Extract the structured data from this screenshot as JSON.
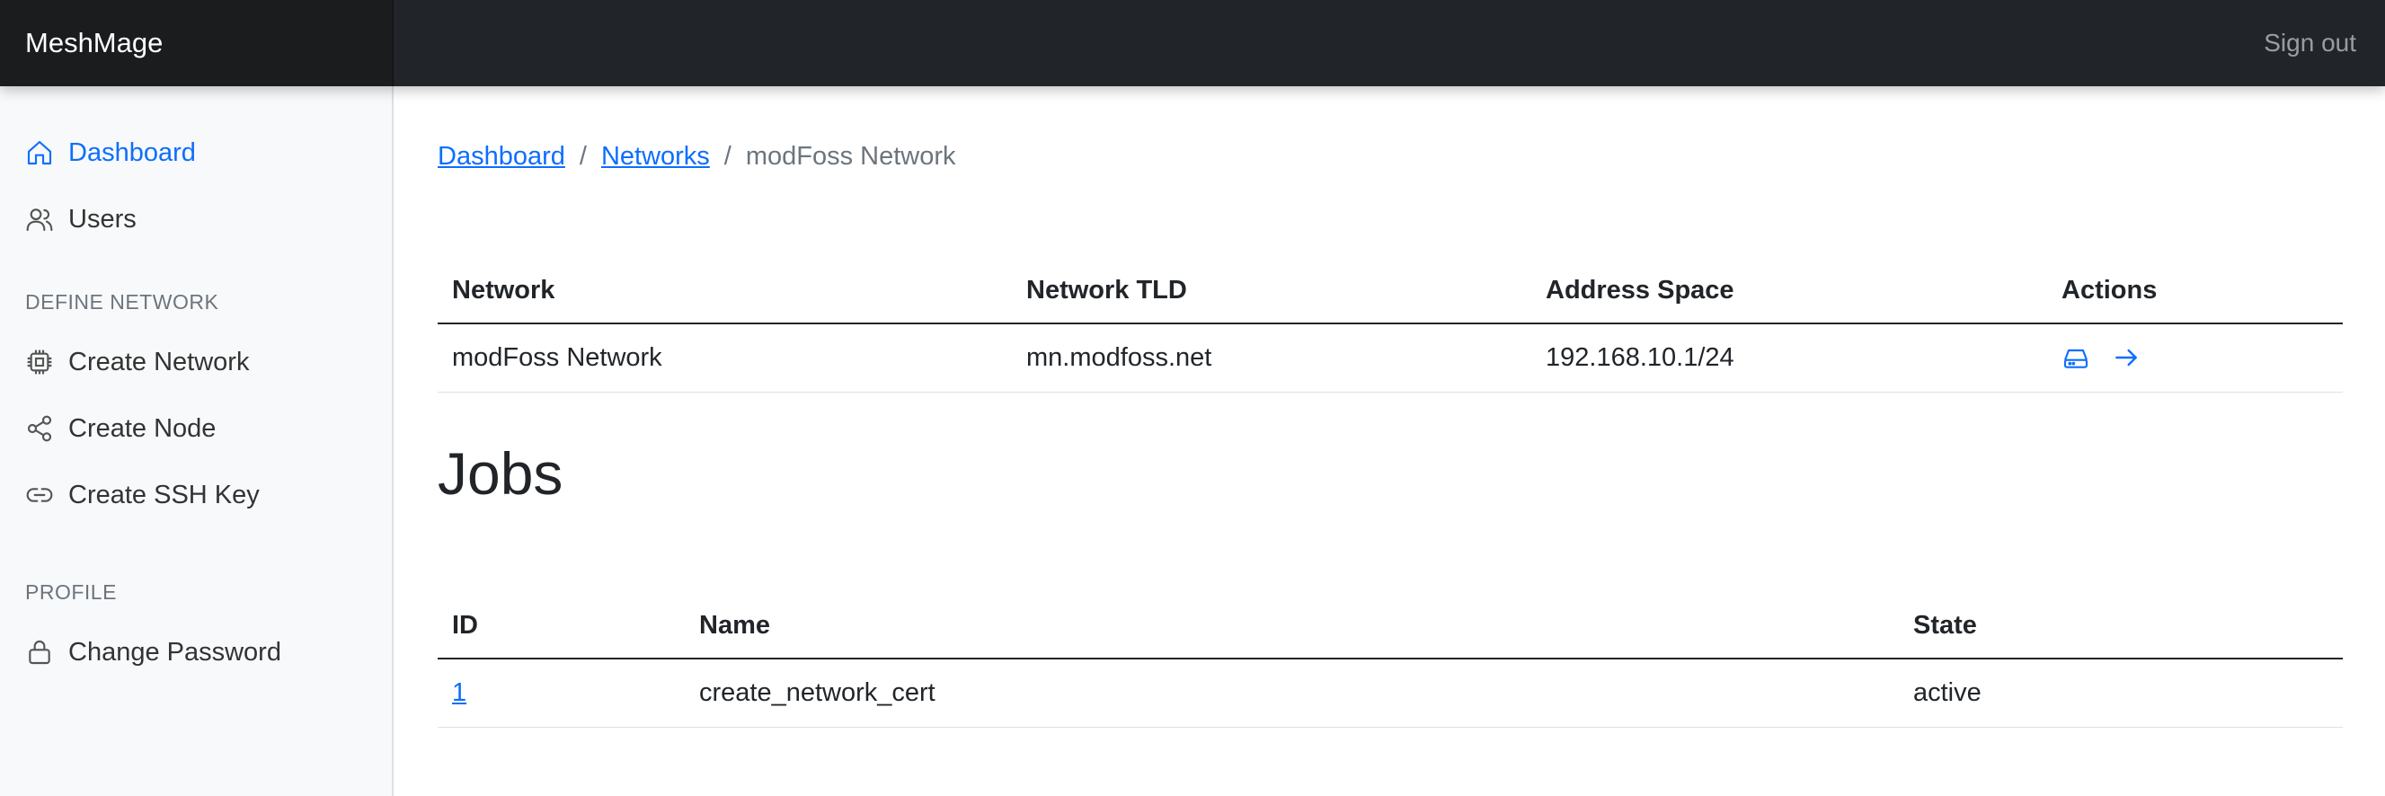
{
  "app": {
    "brand": "MeshMage",
    "sign_out": "Sign out"
  },
  "sidebar": {
    "items": [
      {
        "label": "Dashboard",
        "icon": "house-icon",
        "active": true
      },
      {
        "label": "Users",
        "icon": "people-icon",
        "active": false
      }
    ],
    "sections": [
      {
        "heading": "DEFINE NETWORK",
        "items": [
          {
            "label": "Create Network",
            "icon": "cpu-icon"
          },
          {
            "label": "Create Node",
            "icon": "share-icon"
          },
          {
            "label": "Create SSH Key",
            "icon": "link-icon"
          }
        ]
      },
      {
        "heading": "PROFILE",
        "items": [
          {
            "label": "Change Password",
            "icon": "lock-icon"
          }
        ]
      }
    ]
  },
  "breadcrumb": {
    "items": [
      "Dashboard",
      "Networks"
    ],
    "current": "modFoss Network",
    "separator": "/"
  },
  "network_table": {
    "headers": [
      "Network",
      "Network TLD",
      "Address Space",
      "Actions"
    ],
    "rows": [
      {
        "network": "modFoss Network",
        "tld": "mn.modfoss.net",
        "address_space": "192.168.10.1/24",
        "actions": [
          "hdd-icon",
          "arrow-right-icon"
        ]
      }
    ]
  },
  "jobs": {
    "title": "Jobs",
    "headers": [
      "ID",
      "Name",
      "State"
    ],
    "rows": [
      {
        "id": "1",
        "name": "create_network_cert",
        "state": "active"
      }
    ]
  },
  "colors": {
    "accent": "#0d6efd",
    "topbar": "#212529",
    "sidebar_bg": "#f8f9fa"
  }
}
